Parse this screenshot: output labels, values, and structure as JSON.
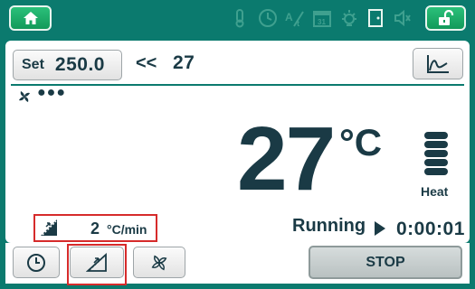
{
  "topbar": {
    "status_icons": [
      "thermometer-icon",
      "clock-icon",
      "auto-icon",
      "calendar-icon",
      "light-icon",
      "door-icon",
      "speaker-icon"
    ]
  },
  "setpoint": {
    "label": "Set",
    "value": "250.0",
    "arrow": "<<",
    "current_target": "27"
  },
  "fan_status": {
    "dots": "●●●"
  },
  "temperature": {
    "value": "27",
    "unit": "°C"
  },
  "heat": {
    "label": "Heat",
    "level_bars": 5
  },
  "rate": {
    "value": "2",
    "unit": "°C/min"
  },
  "status": {
    "label": "Running",
    "elapsed": "0:00:01"
  },
  "buttons": {
    "stop_label": "STOP"
  },
  "colors": {
    "brand": "#0b7a6e",
    "accent_green": "#1aa866",
    "text": "#1a3a45",
    "highlight_red": "#d62b2b"
  }
}
